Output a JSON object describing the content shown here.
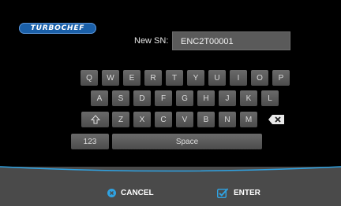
{
  "brand": {
    "logo_text": "TURBOCHEF"
  },
  "sn": {
    "label": "New SN:",
    "value": "ENC2T00001"
  },
  "keyboard": {
    "row1": [
      "Q",
      "W",
      "E",
      "R",
      "T",
      "Y",
      "U",
      "I",
      "O",
      "P"
    ],
    "row2": [
      "A",
      "S",
      "D",
      "F",
      "G",
      "H",
      "J",
      "K",
      "L"
    ],
    "row3": [
      "Z",
      "X",
      "C",
      "V",
      "B",
      "N",
      "M"
    ],
    "numbers_label": "123",
    "space_label": "Space"
  },
  "actions": {
    "cancel_label": "CANCEL",
    "enter_label": "ENTER"
  },
  "colors": {
    "accent": "#2fa3e3",
    "key": "#5b5b5b",
    "bar": "#4a4a4a"
  }
}
